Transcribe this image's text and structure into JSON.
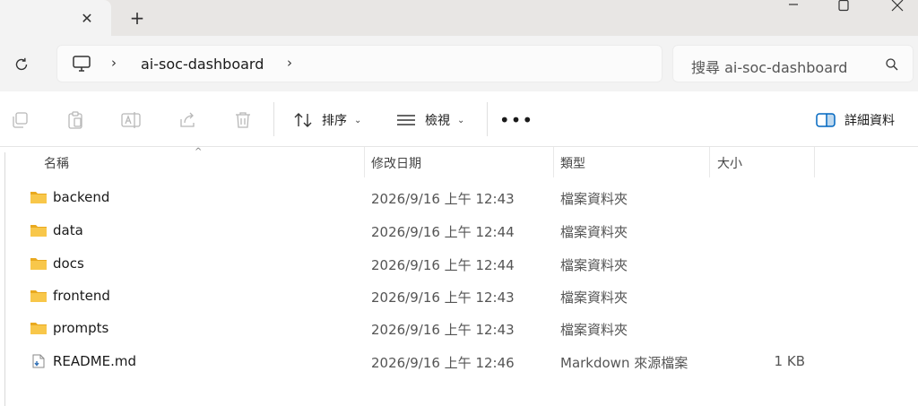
{
  "window": {
    "new_tab_glyph": "+",
    "tab_close_glyph": "✕"
  },
  "address": {
    "computer_icon": "computer-icon",
    "path": "ai-soc-dashboard"
  },
  "search": {
    "placeholder": "搜尋 ai-soc-dashboard"
  },
  "toolbar": {
    "sort_label": "排序",
    "view_label": "檢視",
    "more_label": "•••",
    "details_label": "詳細資料"
  },
  "columns": {
    "name": "名稱",
    "date": "修改日期",
    "type": "類型",
    "size": "大小"
  },
  "files": [
    {
      "name": "backend",
      "date": "2026/9/16 上午 12:43",
      "type": "檔案資料夾",
      "size": "",
      "icon": "folder-icon"
    },
    {
      "name": "data",
      "date": "2026/9/16 上午 12:44",
      "type": "檔案資料夾",
      "size": "",
      "icon": "folder-icon"
    },
    {
      "name": "docs",
      "date": "2026/9/16 上午 12:44",
      "type": "檔案資料夾",
      "size": "",
      "icon": "folder-icon"
    },
    {
      "name": "frontend",
      "date": "2026/9/16 上午 12:43",
      "type": "檔案資料夾",
      "size": "",
      "icon": "folder-icon"
    },
    {
      "name": "prompts",
      "date": "2026/9/16 上午 12:43",
      "type": "檔案資料夾",
      "size": "",
      "icon": "folder-icon"
    },
    {
      "name": "README.md",
      "date": "2026/9/16 上午 12:46",
      "type": "Markdown 來源檔案",
      "size": "1 KB",
      "icon": "markdown-file-icon"
    }
  ],
  "colors": {
    "folder": "#f8c74a",
    "folder_dark": "#e9a91f",
    "accent": "#0067c0"
  }
}
